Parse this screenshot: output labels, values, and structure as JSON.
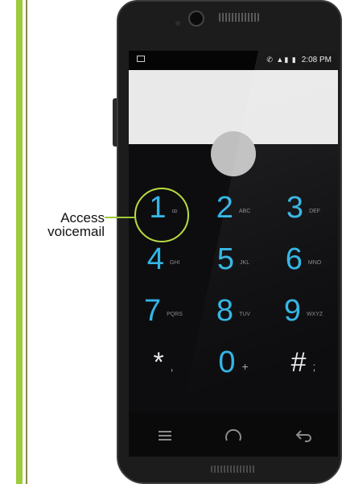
{
  "colors": {
    "accent": "#33b5e5",
    "callout": "#9ccb3b"
  },
  "status_bar": {
    "time": "2:08 PM",
    "icons": "✆ ▲▮ ▮"
  },
  "keypad": {
    "keys": [
      {
        "digit": "1",
        "letters": "ꝏ"
      },
      {
        "digit": "2",
        "letters": "ABC"
      },
      {
        "digit": "3",
        "letters": "DEF"
      },
      {
        "digit": "4",
        "letters": "GHI"
      },
      {
        "digit": "5",
        "letters": "JKL"
      },
      {
        "digit": "6",
        "letters": "MNO"
      },
      {
        "digit": "7",
        "letters": "PQRS"
      },
      {
        "digit": "8",
        "letters": "TUV"
      },
      {
        "digit": "9",
        "letters": "WXYZ"
      },
      {
        "digit": "*",
        "letters": ","
      },
      {
        "digit": "0",
        "letters": "+"
      },
      {
        "digit": "#",
        "letters": ";"
      }
    ]
  },
  "callout": {
    "line1": "Access",
    "line2": "voicemail"
  },
  "icons": {
    "history": "history-icon",
    "call": "phone-icon",
    "overflow": "overflow-menu-icon",
    "recent_apps": "recent-apps-icon",
    "home": "home-icon",
    "back": "back-icon"
  }
}
